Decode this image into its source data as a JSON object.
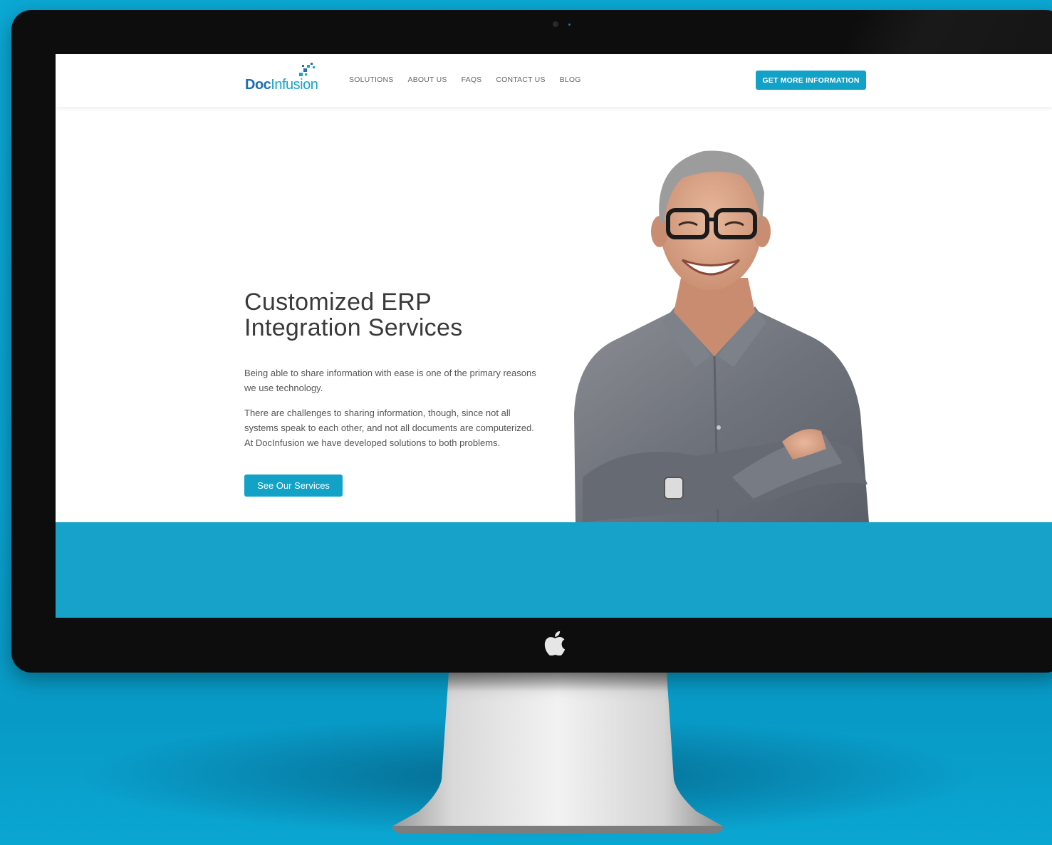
{
  "header": {
    "logo": {
      "part1": "Doc",
      "part2": "Infusion"
    },
    "nav": [
      "SOLUTIONS",
      "ABOUT US",
      "FAQS",
      "CONTACT US",
      "BLOG"
    ],
    "cta_label": "GET MORE INFORMATION"
  },
  "hero": {
    "title_line1": "Customized ERP",
    "title_line2": "Integration Services",
    "paragraph1": "Being able to share information with ease is one of the primary reasons we use technology.",
    "paragraph2": "There are challenges to sharing information, though, since not all systems speak to each other, and not all documents are computerized. At DocInfusion we have developed solutions to both problems.",
    "button_label": "See Our Services"
  },
  "colors": {
    "background": "#0aa6d2",
    "brand_blue": "#12a2c8",
    "logo_dark": "#1d6fb0",
    "band": "#17a3c9"
  },
  "icons": {
    "apple": "apple-logo-icon",
    "logo_mark": "pixel-arrow-icon"
  }
}
